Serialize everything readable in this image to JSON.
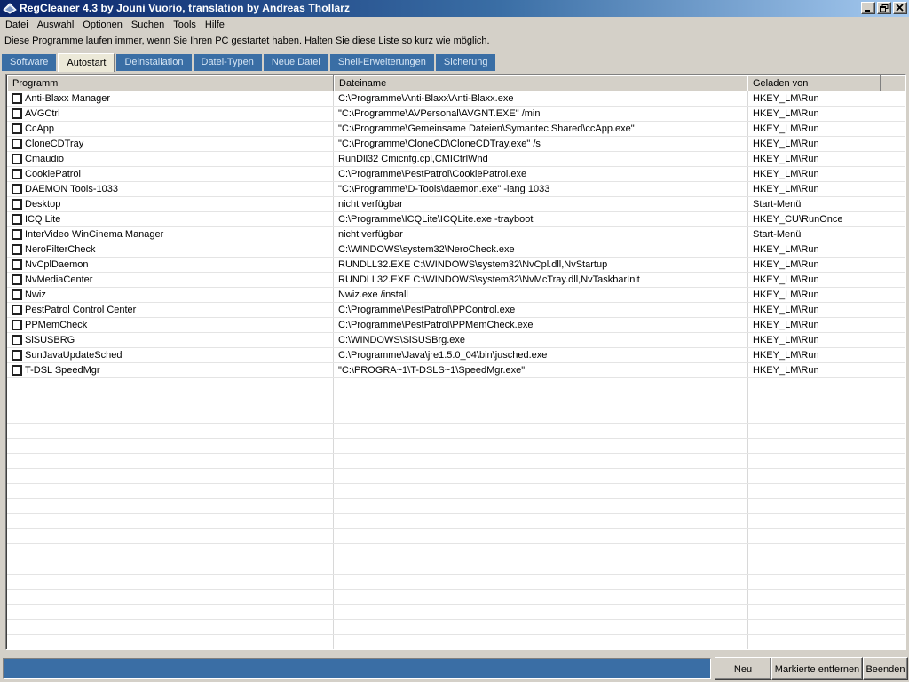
{
  "window": {
    "title": "RegCleaner 4.3 by Jouni Vuorio, translation by Andreas Thollarz",
    "icon": "regcleaner-app-icon"
  },
  "menu": [
    "Datei",
    "Auswahl",
    "Optionen",
    "Suchen",
    "Tools",
    "Hilfe"
  ],
  "info_text": "Diese Programme laufen immer, wenn Sie Ihren PC gestartet haben. Halten Sie diese Liste so kurz wie möglich.",
  "tabs": [
    {
      "label": "Software",
      "active": false
    },
    {
      "label": "Autostart",
      "active": true
    },
    {
      "label": "Deinstallation",
      "active": false
    },
    {
      "label": "Datei-Typen",
      "active": false
    },
    {
      "label": "Neue Datei",
      "active": false
    },
    {
      "label": "Shell-Erweiterungen",
      "active": false
    },
    {
      "label": "Sicherung",
      "active": false
    }
  ],
  "columns": [
    "Programm",
    "Dateiname",
    "Geladen von"
  ],
  "rows": [
    [
      "Anti-Blaxx Manager",
      "C:\\Programme\\Anti-Blaxx\\Anti-Blaxx.exe",
      "HKEY_LM\\Run"
    ],
    [
      "AVGCtrl",
      "\"C:\\Programme\\AVPersonal\\AVGNT.EXE\" /min",
      "HKEY_LM\\Run"
    ],
    [
      "CcApp",
      "\"C:\\Programme\\Gemeinsame Dateien\\Symantec Shared\\ccApp.exe\"",
      "HKEY_LM\\Run"
    ],
    [
      "CloneCDTray",
      "\"C:\\Programme\\CloneCD\\CloneCDTray.exe\" /s",
      "HKEY_LM\\Run"
    ],
    [
      "Cmaudio",
      "RunDll32 Cmicnfg.cpl,CMICtrlWnd",
      "HKEY_LM\\Run"
    ],
    [
      "CookiePatrol",
      "C:\\Programme\\PestPatrol\\CookiePatrol.exe",
      "HKEY_LM\\Run"
    ],
    [
      "DAEMON Tools-1033",
      "\"C:\\Programme\\D-Tools\\daemon.exe\"  -lang 1033",
      "HKEY_LM\\Run"
    ],
    [
      "Desktop",
      "nicht verfügbar",
      "Start-Menü"
    ],
    [
      "ICQ Lite",
      "C:\\Programme\\ICQLite\\ICQLite.exe -trayboot",
      "HKEY_CU\\RunOnce"
    ],
    [
      "InterVideo WinCinema Manager",
      "nicht verfügbar",
      "Start-Menü"
    ],
    [
      "NeroFilterCheck",
      "C:\\WINDOWS\\system32\\NeroCheck.exe",
      "HKEY_LM\\Run"
    ],
    [
      "NvCplDaemon",
      "RUNDLL32.EXE C:\\WINDOWS\\system32\\NvCpl.dll,NvStartup",
      "HKEY_LM\\Run"
    ],
    [
      "NvMediaCenter",
      "RUNDLL32.EXE C:\\WINDOWS\\system32\\NvMcTray.dll,NvTaskbarInit",
      "HKEY_LM\\Run"
    ],
    [
      "Nwiz",
      "Nwiz.exe /install",
      "HKEY_LM\\Run"
    ],
    [
      "PestPatrol Control Center",
      "C:\\Programme\\PestPatrol\\PPControl.exe",
      "HKEY_LM\\Run"
    ],
    [
      "PPMemCheck",
      "C:\\Programme\\PestPatrol\\PPMemCheck.exe",
      "HKEY_LM\\Run"
    ],
    [
      "SiSUSBRG",
      "C:\\WINDOWS\\SiSUSBrg.exe",
      "HKEY_LM\\Run"
    ],
    [
      "SunJavaUpdateSched",
      "C:\\Programme\\Java\\jre1.5.0_04\\bin\\jusched.exe",
      "HKEY_LM\\Run"
    ],
    [
      "T-DSL SpeedMgr",
      "\"C:\\PROGRA~1\\T-DSLS~1\\SpeedMgr.exe\"",
      "HKEY_LM\\Run"
    ]
  ],
  "buttons": {
    "new": "Neu",
    "remove": "Markierte entfernen",
    "exit": "Beenden"
  },
  "colors": {
    "title_start": "#0a246a",
    "tab_inactive": "#3a6ea5",
    "progress": "#3a6ea5",
    "face": "#d4d0c8"
  }
}
